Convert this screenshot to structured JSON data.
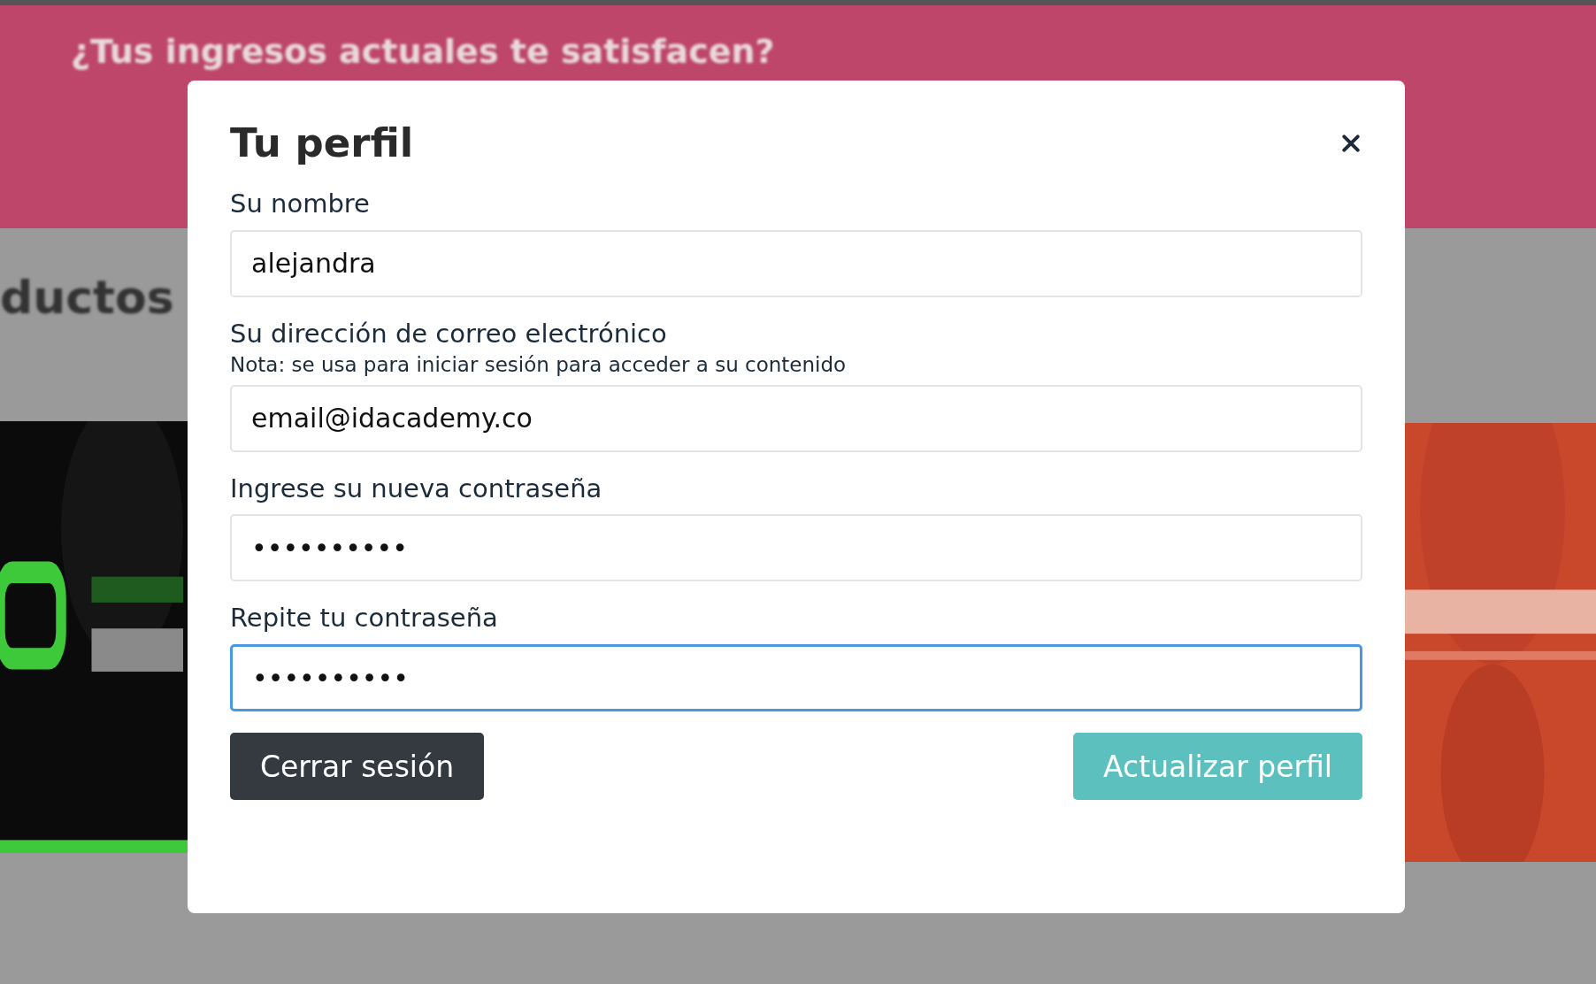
{
  "background": {
    "banner": {
      "headline": "¿Tus ingresos actuales te satisfacen?"
    },
    "section_heading": "ductos"
  },
  "modal": {
    "title": "Tu perfil",
    "fields": [
      {
        "label": "Su nombre",
        "value": "alejandra",
        "focused": false
      },
      {
        "label": "Su dirección de correo electrónico",
        "note": "Nota: se usa para iniciar sesión para acceder a su contenido",
        "value": "email@idacademy.co",
        "focused": false
      },
      {
        "label": "Ingrese su nueva contraseña",
        "value": "••••••••••",
        "focused": false
      },
      {
        "label": "Repite tu contraseña",
        "value": "••••••••••",
        "focused": true
      }
    ],
    "buttons": [
      {
        "label": "Cerrar sesión",
        "kind": "secondary"
      },
      {
        "label": "Actualizar perfil",
        "kind": "primary"
      }
    ]
  }
}
